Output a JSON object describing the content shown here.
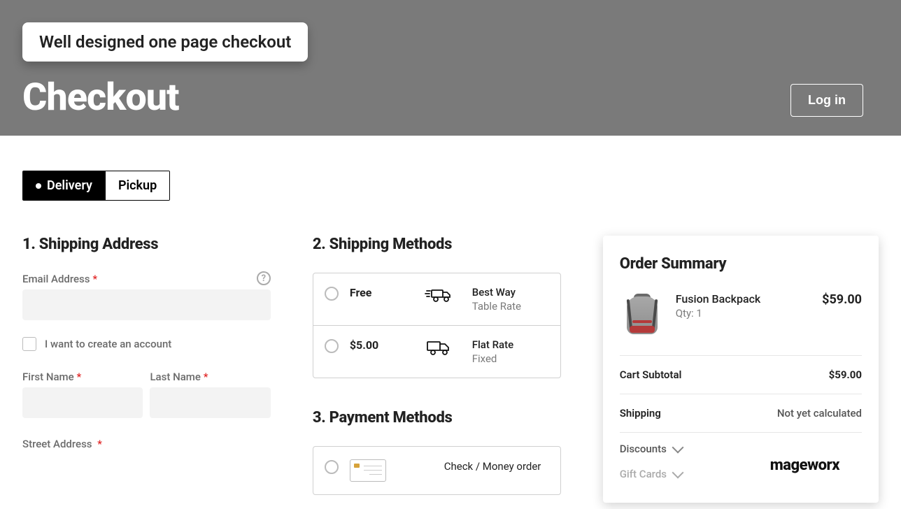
{
  "badge_text": "Well designed one page checkout",
  "page_title": "Checkout",
  "login_label": "Log in",
  "tabs": {
    "delivery": "Delivery",
    "pickup": "Pickup"
  },
  "shipping_address": {
    "heading": "1. Shipping Address",
    "email_label": "Email Address",
    "create_account_label": "I want to create an account",
    "first_name_label": "First Name",
    "last_name_label": "Last Name",
    "street_label": "Street Address"
  },
  "shipping_methods": {
    "heading": "2. Shipping Methods",
    "options": [
      {
        "price": "Free",
        "title": "Best Way",
        "sub": "Table Rate"
      },
      {
        "price": "$5.00",
        "title": "Flat Rate",
        "sub": "Fixed"
      }
    ]
  },
  "payment_methods": {
    "heading": "3. Payment Methods",
    "option_label": "Check / Money order"
  },
  "order_summary": {
    "heading": "Order Summary",
    "product": {
      "name": "Fusion Backpack",
      "qty_label": "Qty: 1",
      "price": "$59.00"
    },
    "subtotal_label": "Cart Subtotal",
    "subtotal_value": "$59.00",
    "shipping_label": "Shipping",
    "shipping_value": "Not yet calculated",
    "discounts_label": "Discounts",
    "giftcards_label": "Gift Cards"
  },
  "brand": "mageworx"
}
